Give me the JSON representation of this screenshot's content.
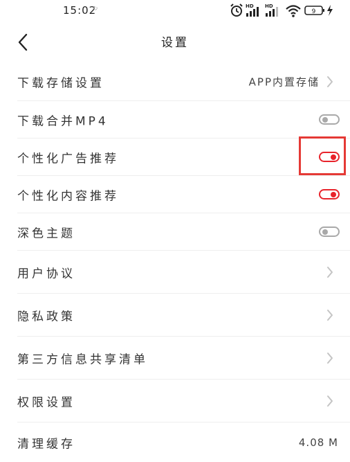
{
  "status_bar": {
    "time": "15:02",
    "notification_glyph": "↻",
    "icons": [
      "alarm-icon",
      "hd-signal-icon",
      "hd-signal-icon",
      "wifi-icon",
      "battery-icon",
      "charging-icon"
    ],
    "signal_badge": "HD",
    "battery_level": "9"
  },
  "header": {
    "back_icon": "chevron-left-icon",
    "title": "设置"
  },
  "settings": {
    "items": [
      {
        "label": "下载存储设置",
        "value": "APP内置存储",
        "control": "chevron-right-icon"
      },
      {
        "label": "下载合并MP4",
        "control": "toggle",
        "enabled": false
      },
      {
        "label": "个性化广告推荐",
        "control": "toggle",
        "enabled": true,
        "highlighted": true
      },
      {
        "label": "个性化内容推荐",
        "control": "toggle",
        "enabled": true
      },
      {
        "label": "深色主题",
        "control": "toggle",
        "enabled": false
      },
      {
        "label": "用户协议",
        "control": "chevron-right-icon"
      },
      {
        "label": "隐私政策",
        "control": "chevron-right-icon"
      },
      {
        "label": "第三方信息共享清单",
        "control": "chevron-right-icon"
      },
      {
        "label": "权限设置",
        "control": "chevron-right-icon"
      },
      {
        "label": "清理缓存",
        "value": "4.08 M"
      }
    ]
  },
  "colors": {
    "accent_red": "#e8232b",
    "toggle_off_gray": "#a9a9a9",
    "highlight_box": "#e53935",
    "divider": "#eeeeee"
  }
}
